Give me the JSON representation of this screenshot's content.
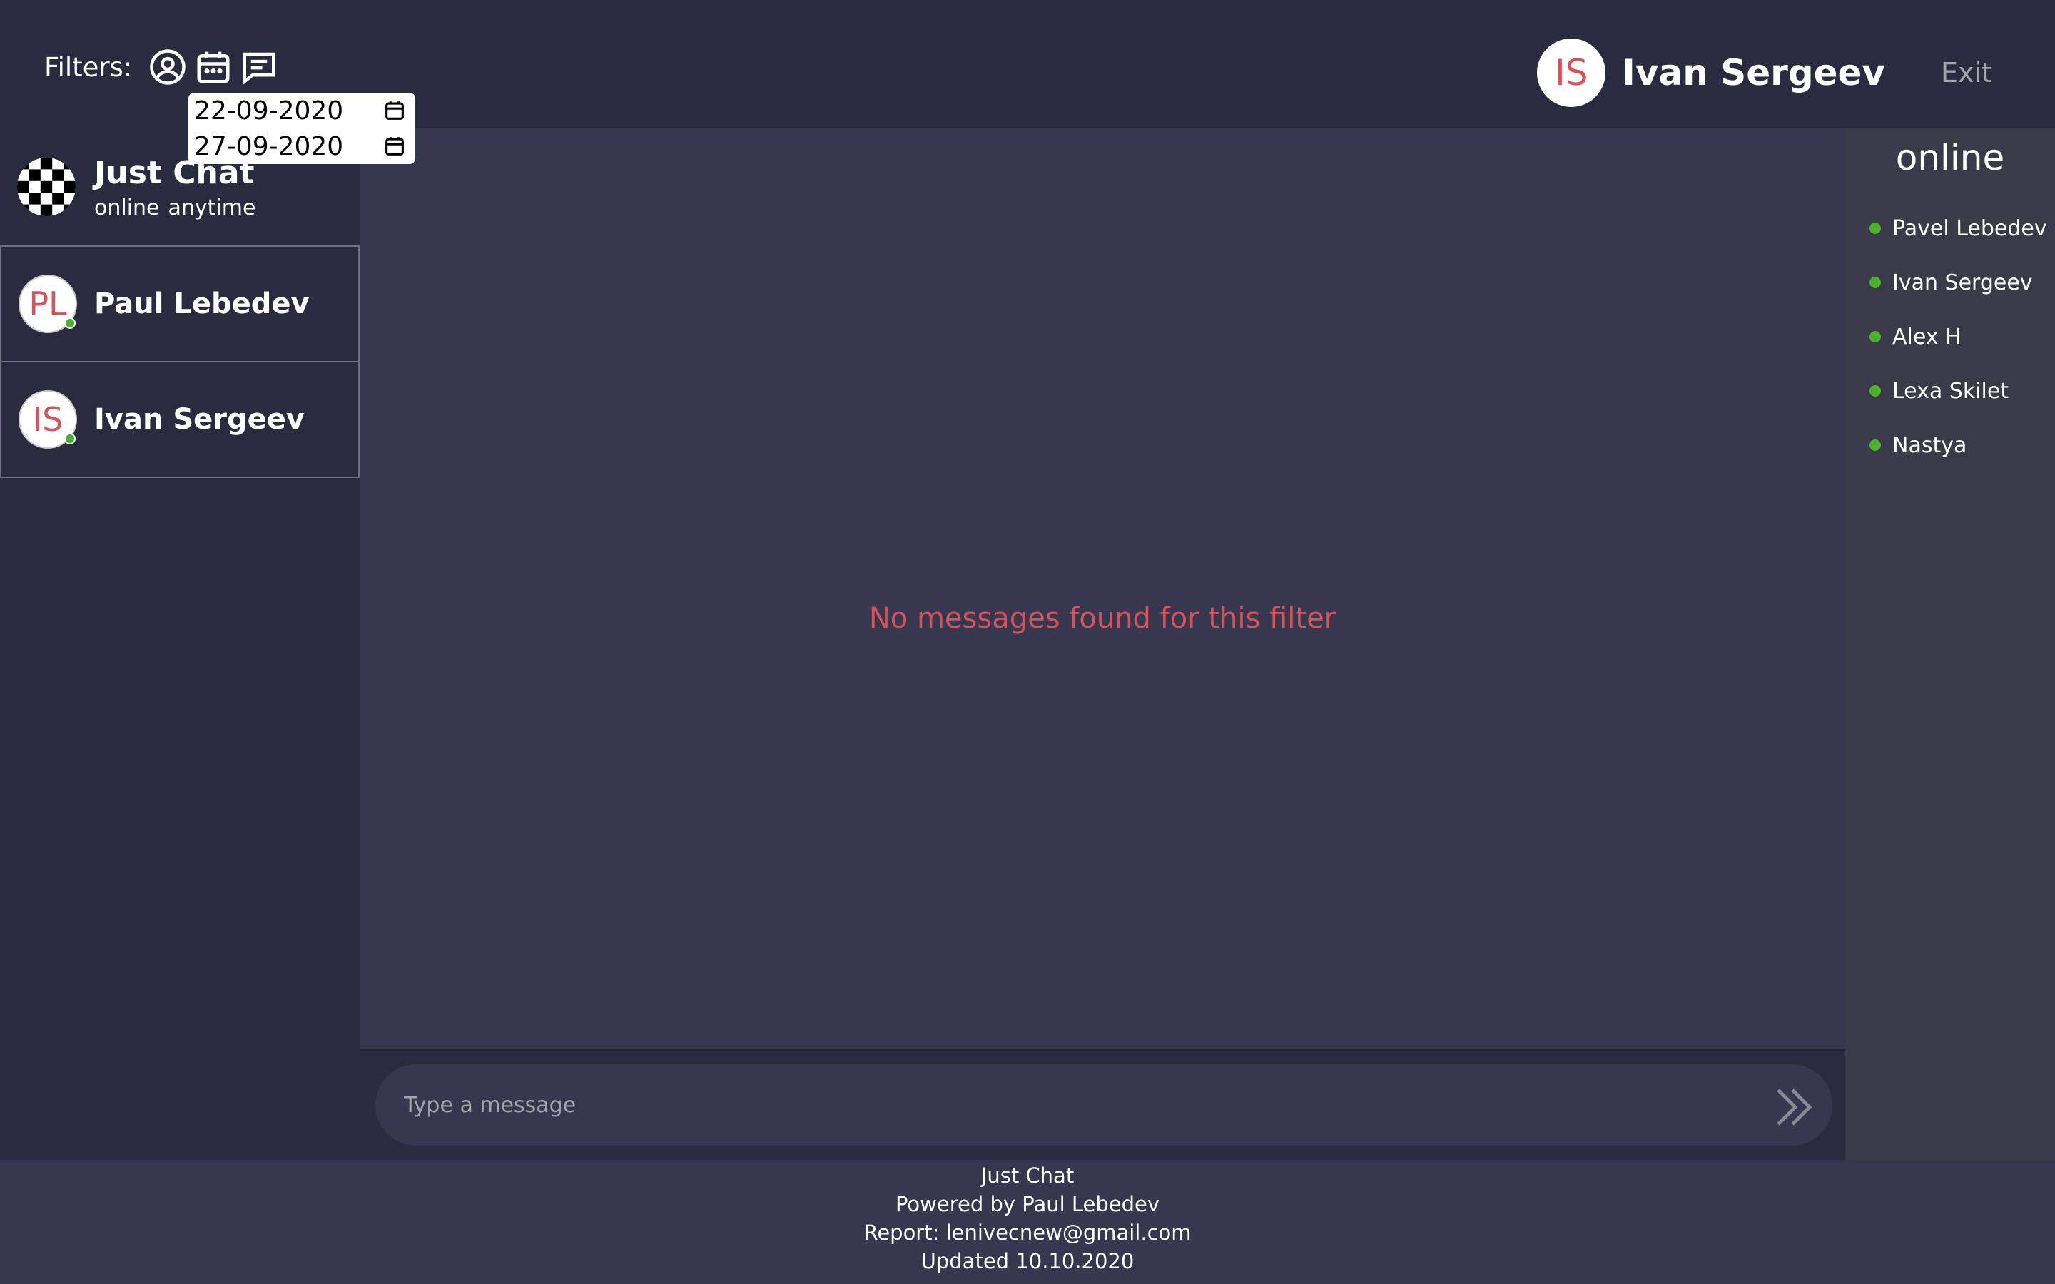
{
  "header": {
    "filters_label": "Filters:",
    "filter_icons": [
      "user-circle-icon",
      "calendar-icon",
      "message-icon"
    ],
    "date_from": "22-09-2020",
    "date_to": "27-09-2020",
    "current_user": {
      "initials": "IS",
      "name": "Ivan Sergeev"
    },
    "exit_label": "Exit"
  },
  "sidebar": {
    "chat": {
      "title": "Just Chat",
      "status_1": "online",
      "status_2": "anytime"
    },
    "contacts": [
      {
        "initials": "PL",
        "name": "Paul Lebedev",
        "online": true
      },
      {
        "initials": "IS",
        "name": "Ivan Sergeev",
        "online": true
      }
    ]
  },
  "main": {
    "empty_message": "No messages found for this filter",
    "composer_placeholder": "Type a message"
  },
  "online": {
    "title": "online",
    "users": [
      "Pavel Lebedev",
      "Ivan Sergeev",
      "Alex H",
      "Lexa Skilet",
      "Nastya"
    ]
  },
  "footer": {
    "line1": "Just Chat",
    "line2": "Powered by Paul Lebedev",
    "line3": "Report:  lenivecnew@gmail.com",
    "line4": "Updated 10.10.2020"
  },
  "colors": {
    "background": "#2b2b3f",
    "panel": "#37374f",
    "online_panel": "#3a3a48",
    "accent_red": "#d2555c",
    "online_green": "#4ab02d"
  }
}
